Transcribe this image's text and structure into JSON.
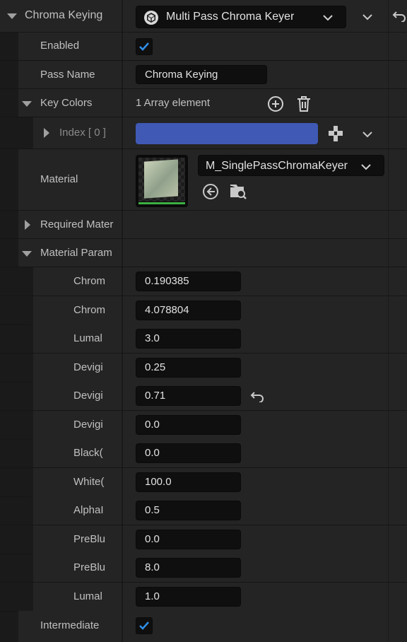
{
  "header": {
    "category_label": "Chroma Keying",
    "class_dropdown_label": "Multi Pass Chroma Keyer"
  },
  "properties": {
    "enabled": {
      "label": "Enabled",
      "checked": true
    },
    "pass_name": {
      "label": "Pass Name",
      "value": "Chroma Keying"
    },
    "key_colors": {
      "label": "Key Colors",
      "summary": "1 Array element"
    },
    "key_color_index": {
      "label": "Index [ 0 ]",
      "color": "#3f59b5"
    },
    "material": {
      "label": "Material",
      "asset_name": "M_SinglePassChromaKeyer"
    },
    "required_materials": {
      "label": "Required Mater"
    },
    "material_params": {
      "label": "Material Param"
    },
    "intermediate": {
      "label": "Intermediate",
      "checked": true
    }
  },
  "params": [
    {
      "label": "Chrom",
      "value": "0.190385"
    },
    {
      "label": "Chrom",
      "value": "4.078804"
    },
    {
      "label": "Lumal",
      "value": "3.0"
    },
    {
      "label": "Devigi",
      "value": "0.25"
    },
    {
      "label": "Devigi",
      "value": "0.71",
      "modified": true
    },
    {
      "label": "Devigi",
      "value": "0.0"
    },
    {
      "label": "Black(",
      "value": "0.0"
    },
    {
      "label": "White(",
      "value": "100.0"
    },
    {
      "label": "AlphaI",
      "value": "0.5"
    },
    {
      "label": "PreBlu",
      "value": "0.0"
    },
    {
      "label": "PreBlu",
      "value": "8.0"
    },
    {
      "label": "Lumal",
      "value": "1.0"
    }
  ],
  "colors": {
    "accent_check": "#2f8fe8",
    "swatch": "#3f59b5",
    "thumbnail_underline": "#3cb043"
  }
}
